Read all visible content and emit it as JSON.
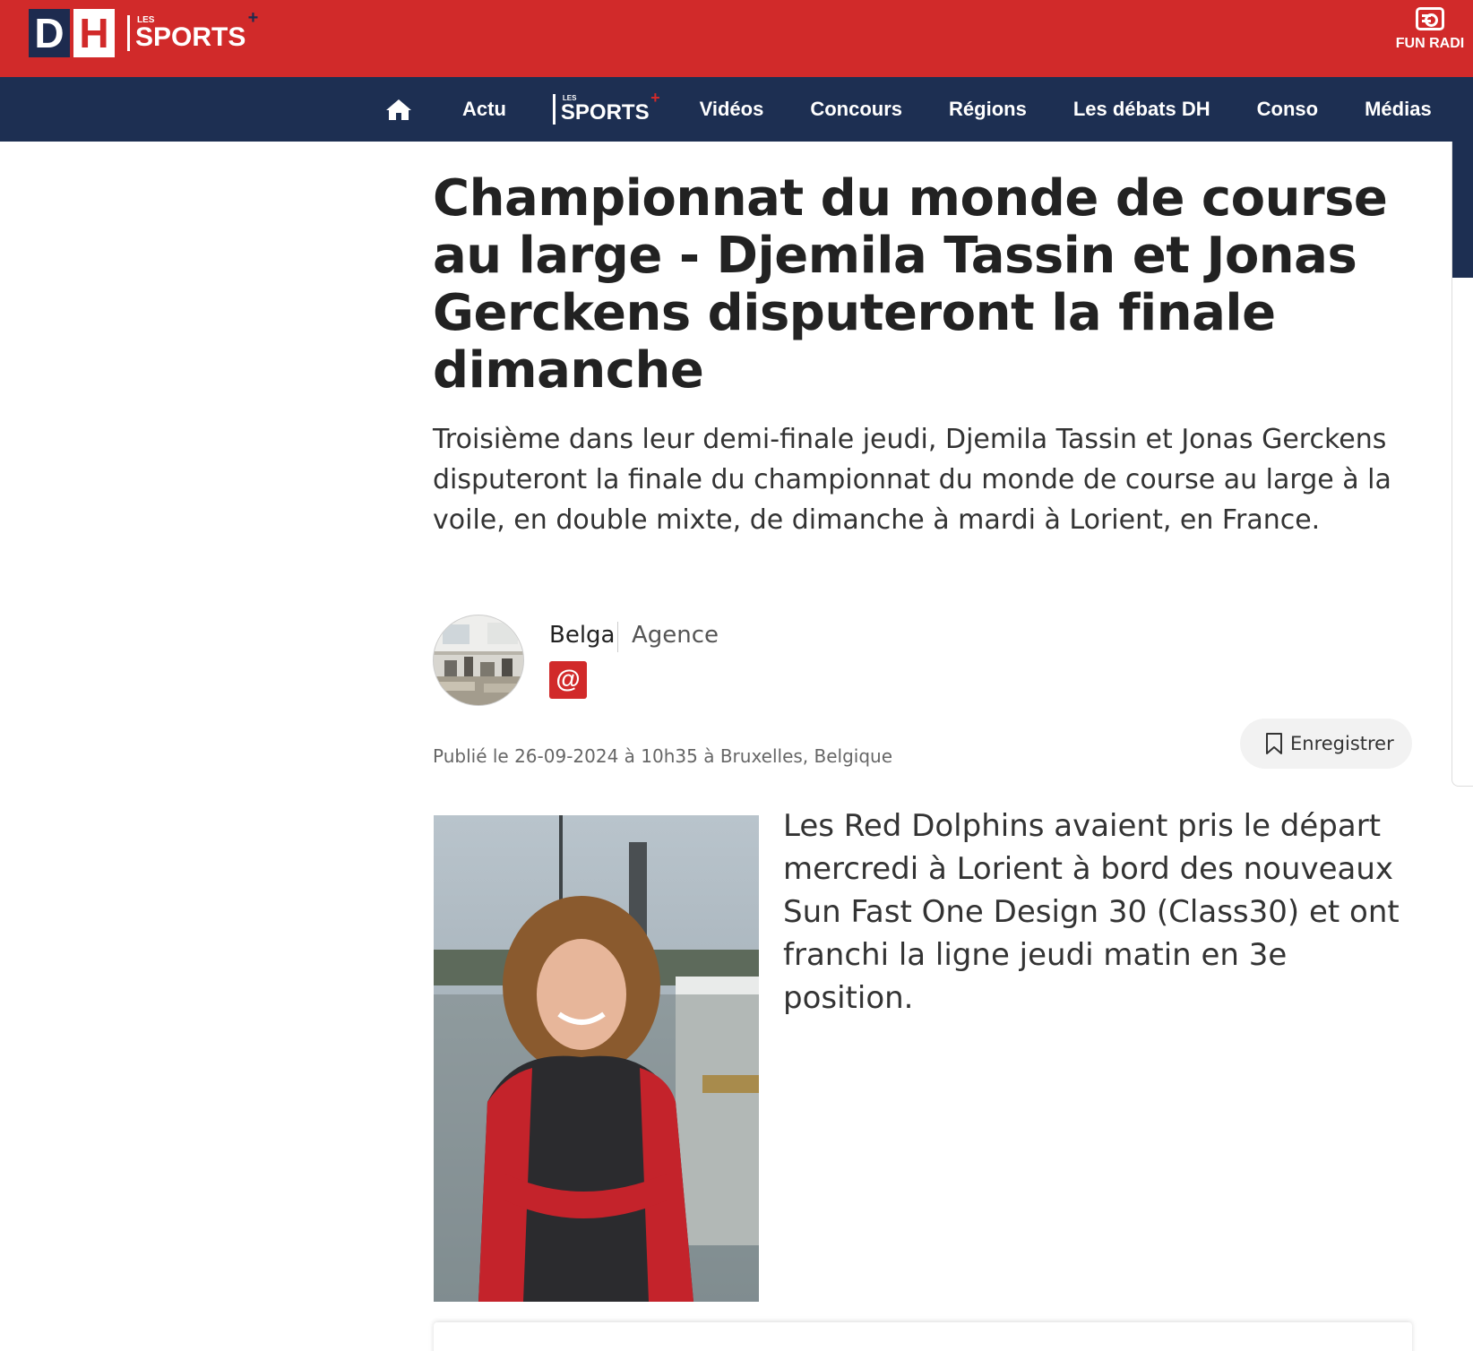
{
  "header": {
    "logo_d": "D",
    "logo_h": "H",
    "logo_les": "LES",
    "logo_sports": "SPORTS",
    "logo_plus": "+",
    "radio_label": "FUN RADI",
    "radio_icon": "radio-icon",
    "brand_red": "#d12a2a",
    "brand_navy": "#1d2f52"
  },
  "nav": {
    "home_icon": "home-icon",
    "items": [
      "Actu",
      "Vidéos",
      "Concours",
      "Régions",
      "Les débats DH",
      "Conso",
      "Médias"
    ],
    "sports_les": "LES",
    "sports_label": "SPORTS",
    "sports_plus": "+"
  },
  "article": {
    "headline": "Championnat du monde de course au large - Djemila Tassin et Jonas Gerckens disputeront la finale dimanche",
    "lede": "Troisième dans leur demi-finale jeudi, Djemila Tassin et Jonas Gerckens disputeront la finale du championnat du monde de course au large à la voile, en double mixte, de dimanche à mardi à Lorient, en France.",
    "author_name": "Belga",
    "author_role": "Agence",
    "email_label": "@",
    "published": "Publié le 26-09-2024 à 10h35  à Bruxelles, Belgique",
    "save_label": "Enregistrer",
    "body": "Les Red Dolphins avaient pris le départ mercredi à Lorient à bord des nouveaux Sun Fast One Design 30 (Class30) et ont franchi la ligne jeudi matin en 3e position."
  }
}
